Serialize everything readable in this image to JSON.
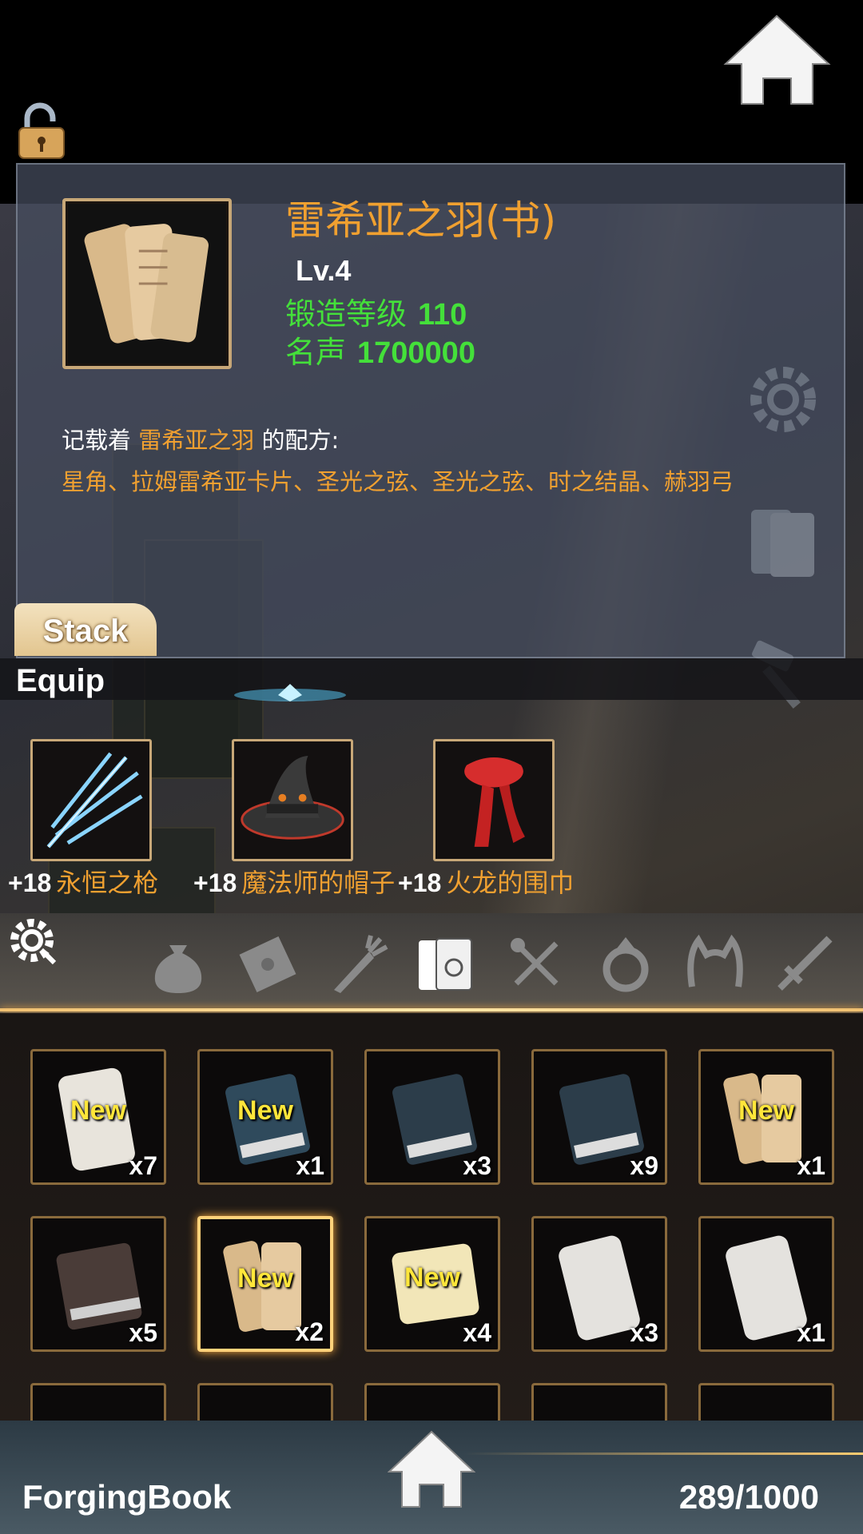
{
  "top": {
    "home_icon": "home-icon",
    "lock_icon": "unlock-icon"
  },
  "detail": {
    "title": "雷希亚之羽(书)",
    "level": "Lv.4",
    "forge_label": "锻造等级",
    "forge_value": "110",
    "fame_label": "名声",
    "fame_value": "1700000",
    "desc_prefix": "记载着",
    "desc_item": "雷希亚之羽",
    "desc_suffix": "的配方:",
    "recipe": "星角、拉姆雷希亚卡片、圣光之弦、圣光之弦、时之结晶、赫羽弓"
  },
  "tabs": {
    "stack": "Stack",
    "equip": "Equip"
  },
  "equipment": [
    {
      "plus": "+18",
      "name": "永恒之枪",
      "icon": "lightning-spear-icon"
    },
    {
      "plus": "+18",
      "name": "魔法师的帽子",
      "icon": "wizard-hat-icon"
    },
    {
      "plus": "+18",
      "name": "火龙的围巾",
      "icon": "red-scarf-icon"
    }
  ],
  "categories": [
    "bag-icon",
    "letter-icon",
    "carrot-icon",
    "book-icon",
    "utensils-icon",
    "ring-icon",
    "headband-icon",
    "sword-icon"
  ],
  "grid": [
    {
      "type": "scroll-white",
      "new": "New",
      "count": "x7"
    },
    {
      "type": "book-blue",
      "new": "New",
      "count": "x1"
    },
    {
      "type": "book-blue",
      "new": "",
      "count": "x3"
    },
    {
      "type": "book-blue",
      "new": "",
      "count": "x9"
    },
    {
      "type": "scroll-tan",
      "new": "New",
      "count": "x1"
    },
    {
      "type": "book-brown",
      "new": "",
      "count": "x5"
    },
    {
      "type": "scroll-tan",
      "new": "New",
      "count": "x2"
    },
    {
      "type": "scroll-cream",
      "new": "New",
      "count": "x4"
    },
    {
      "type": "scroll-white",
      "new": "",
      "count": "x3"
    },
    {
      "type": "scroll-white",
      "new": "",
      "count": "x1"
    }
  ],
  "bottom": {
    "label": "ForgingBook",
    "capacity": "289/1000"
  },
  "colors": {
    "accent_orange": "#f0a030",
    "stat_green": "#44e03a",
    "gold_frame": "#c8a878",
    "new_yellow": "#ffe63a"
  }
}
